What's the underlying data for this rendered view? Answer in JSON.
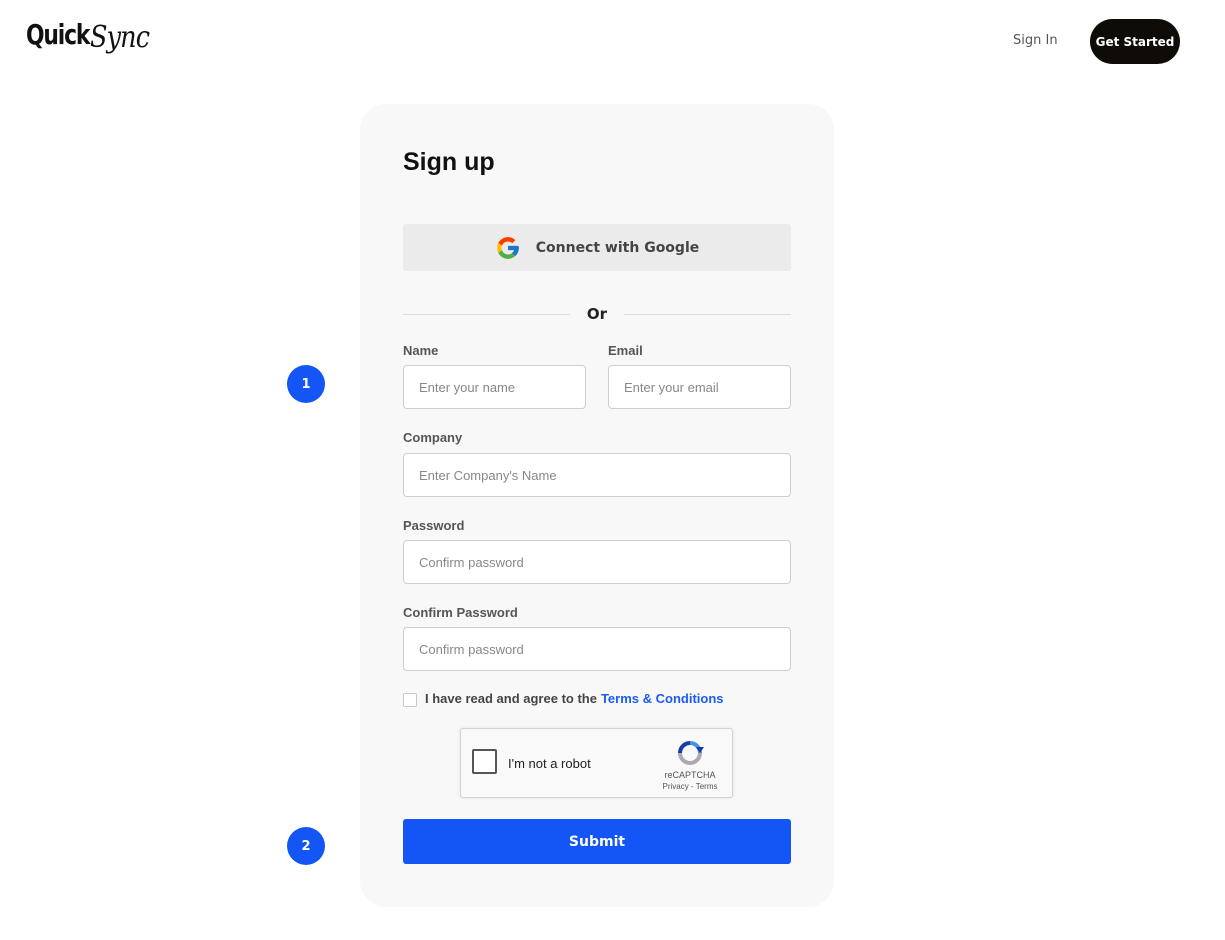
{
  "header": {
    "logo_quick": "Quick",
    "logo_sync": "Sync",
    "sign_in": "Sign In",
    "get_started": "Get Started"
  },
  "form": {
    "title": "Sign up",
    "google_button": "Connect with Google",
    "divider": "Or",
    "name": {
      "label": "Name",
      "placeholder": "Enter your name"
    },
    "email": {
      "label": "Email",
      "placeholder": "Enter your email"
    },
    "company": {
      "label": "Company",
      "placeholder": "Enter Company's Name"
    },
    "password": {
      "label": "Password",
      "placeholder": "Confirm password"
    },
    "confirm_password": {
      "label": "Confirm Password",
      "placeholder": "Confirm password"
    },
    "terms_text": "I have read and agree to the",
    "terms_link": "Terms & Conditions",
    "recaptcha": {
      "label": "I'm not a robot",
      "brand": "reCAPTCHA",
      "links": "Privacy - Terms"
    },
    "submit": "Submit"
  },
  "steps": [
    "1",
    "2"
  ],
  "colors": {
    "accent": "#1456f5",
    "dark_button": "#0f0c08",
    "card_bg": "#f8f8f8"
  },
  "icons": [
    "google-icon",
    "recaptcha-icon"
  ]
}
